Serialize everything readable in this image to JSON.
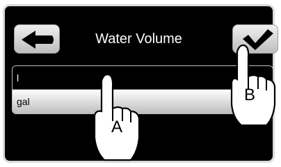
{
  "screen": {
    "title": "Water Volume",
    "back_icon": "arrow-left-icon",
    "confirm_icon": "checkmark-icon"
  },
  "list": {
    "items": [
      {
        "label": "l",
        "selected": false
      },
      {
        "label": "gal",
        "selected": true
      }
    ]
  },
  "callouts": {
    "a": "A",
    "b": "B"
  }
}
